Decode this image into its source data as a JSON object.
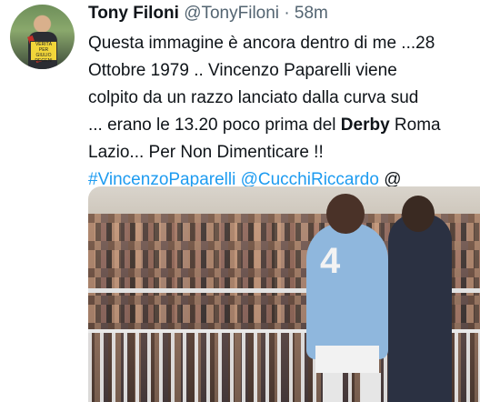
{
  "author": {
    "name": "Tony Filoni",
    "handle": "@TonyFiloni",
    "separator": "·",
    "time": "58m"
  },
  "tweet": {
    "lines": [
      "Questa immagine è ancora dentro di me ...28",
      "Ottobre 1979 .. Vincenzo Paparelli viene",
      "colpito da un razzo lanciato dalla curva sud",
      "... erano le 13.20 poco prima del "
    ],
    "bold_word": "Derby",
    "line4_tail": " Roma",
    "line5": "Lazio... Per Non Dimenticare !!",
    "hashtag": "#VincenzoPaparelli",
    "mention": "@CucchiRiccardo",
    "trailing": " @"
  },
  "avatar_sign": "VERITÀ PER GIULIO REGENI",
  "icons": [
    "avatar",
    "tweet-photo"
  ]
}
